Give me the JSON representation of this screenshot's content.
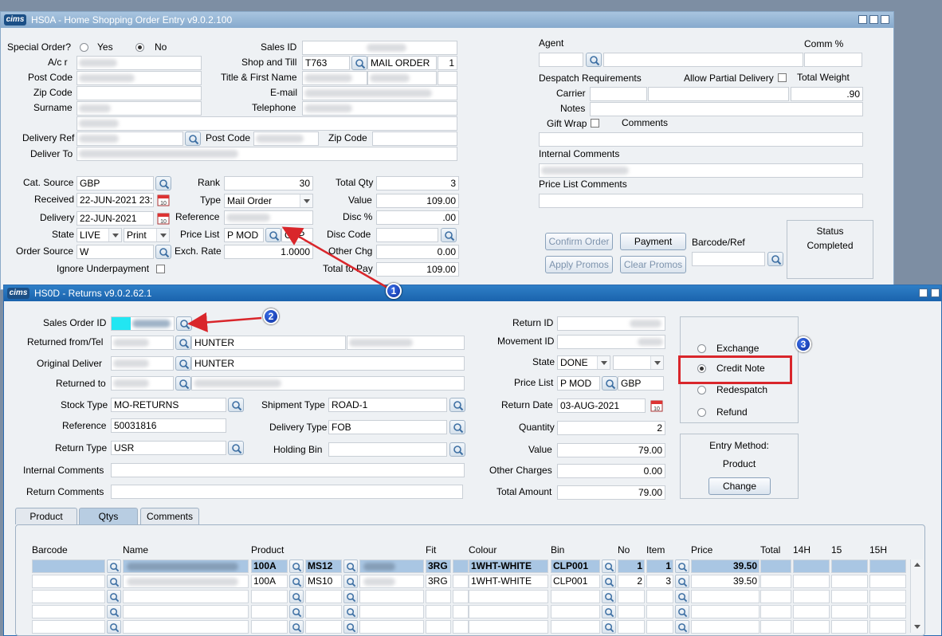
{
  "top_window": {
    "title": "HS0A - Home Shopping Order Entry v9.0.2.100",
    "logo": "cims",
    "special_order_label": "Special Order?",
    "yes_label": "Yes",
    "no_label": "No",
    "ac_label": "A/c r",
    "post_code_label": "Post Code",
    "zip_code_label": "Zip Code",
    "surname_label": "Surname",
    "sales_id_label": "Sales ID",
    "shop_till_label": "Shop and Till",
    "shop_value": "T763",
    "shop_name": "MAIL ORDER",
    "till_value": "1",
    "title_first_label": "Title & First Name",
    "email_label": "E-mail",
    "telephone_label": "Telephone",
    "delivery_ref_label": "Delivery Ref",
    "delivery_post_code_label": "Post Code",
    "delivery_zip_label": "Zip Code",
    "deliver_to_label": "Deliver To",
    "cat_source_label": "Cat. Source",
    "cat_source_value": "GBP",
    "received_label": "Received",
    "received_value": "22-JUN-2021 23:",
    "delivery_label": "Delivery",
    "delivery_value": "22-JUN-2021",
    "state_label": "State",
    "state_value": "LIVE",
    "print_value": "Print",
    "order_source_label": "Order Source",
    "order_source_value": "W",
    "ignore_underpayment_label": "Ignore Underpayment",
    "rank_label": "Rank",
    "rank_value": "30",
    "type_label": "Type",
    "type_value": "Mail Order",
    "reference_label": "Reference",
    "price_list_label": "Price List",
    "price_list_value": "P MOD",
    "price_list_currency": "GBP",
    "exch_rate_label": "Exch. Rate",
    "exch_rate_value": "1.0000",
    "total_qty_label": "Total Qty",
    "total_qty_value": "3",
    "value_label": "Value",
    "value_value": "109.00",
    "disc_pct_label": "Disc %",
    "disc_pct_value": ".00",
    "disc_code_label": "Disc Code",
    "other_chg_label": "Other Chg",
    "other_chg_value": "0.00",
    "total_to_pay_label": "Total to Pay",
    "total_to_pay_value": "109.00",
    "agent_label": "Agent",
    "comm_label": "Comm %",
    "despatch_label": "Despatch Requirements",
    "allow_partial_label": "Allow Partial Delivery",
    "total_weight_label": "Total Weight",
    "carrier_label": "Carrier",
    "weight_value": ".90",
    "notes_label": "Notes",
    "gift_wrap_label": "Gift Wrap",
    "comments_label": "Comments",
    "internal_comments_label": "Internal Comments",
    "price_list_comments_label": "Price List Comments",
    "confirm_order_label": "Confirm Order",
    "payment_label": "Payment",
    "apply_promos_label": "Apply Promos",
    "clear_promos_label": "Clear Promos",
    "barcode_ref_label": "Barcode/Ref",
    "status_label": "Status",
    "status_value": "Completed"
  },
  "returns_window": {
    "title": "HS0D - Returns v9.0.2.62.1",
    "logo": "cims",
    "sales_order_id_label": "Sales Order ID",
    "returned_from_label": "Returned from/Tel",
    "returned_from_name": "HUNTER",
    "original_deliver_label": "Original Deliver",
    "original_deliver_name": "HUNTER",
    "returned_to_label": "Returned to",
    "stock_type_label": "Stock Type",
    "stock_type_value": "MO-RETURNS",
    "reference_label": "Reference",
    "reference_value": "50031816",
    "return_type_label": "Return Type",
    "return_type_value": "USR",
    "internal_comments_label": "Internal Comments",
    "return_comments_label": "Return Comments",
    "shipment_type_label": "Shipment Type",
    "shipment_type_value": "ROAD-1",
    "delivery_type_label": "Delivery Type",
    "delivery_type_value": "FOB",
    "holding_bin_label": "Holding Bin",
    "return_id_label": "Return ID",
    "movement_id_label": "Movement ID",
    "state_label": "State",
    "state_value": "DONE",
    "price_list_label": "Price List",
    "price_list_value": "P MOD",
    "price_list_currency": "GBP",
    "return_date_label": "Return Date",
    "return_date_value": "03-AUG-2021",
    "quantity_label": "Quantity",
    "quantity_value": "2",
    "value_label": "Value",
    "value_value": "79.00",
    "other_charges_label": "Other Charges",
    "other_charges_value": "0.00",
    "total_amount_label": "Total Amount",
    "total_amount_value": "79.00",
    "options": [
      "Exchange",
      "Credit Note",
      "Redespatch",
      "Refund"
    ],
    "selected_option": "Credit Note",
    "entry_method_label": "Entry Method:",
    "entry_method_value": "Product",
    "change_label": "Change",
    "tabs": [
      "Product",
      "Qtys",
      "Comments"
    ],
    "active_tab": "Qtys",
    "grid_headers": [
      "Barcode",
      "Name",
      "Product",
      "Fit",
      "Colour",
      "Bin",
      "No",
      "Item",
      "Price",
      "Total",
      "14H",
      "15",
      "15H"
    ],
    "rows": [
      {
        "product": "100A",
        "style": "MS12",
        "fit": "3RG",
        "colour": "1WHT-WHITE",
        "bin": "CLP001",
        "no": "1",
        "item": "1",
        "price": "39.50"
      },
      {
        "product": "100A",
        "style": "MS10",
        "fit": "3RG",
        "colour": "1WHT-WHITE",
        "bin": "CLP001",
        "no": "2",
        "item": "3",
        "price": "39.50"
      }
    ]
  },
  "annotations": [
    "1",
    "2",
    "3"
  ],
  "colors": {
    "accent": "#1a63ad",
    "highlight_box": "#d9262b",
    "arrow": "#d9262b",
    "cyan_field": "#22e6f2"
  }
}
